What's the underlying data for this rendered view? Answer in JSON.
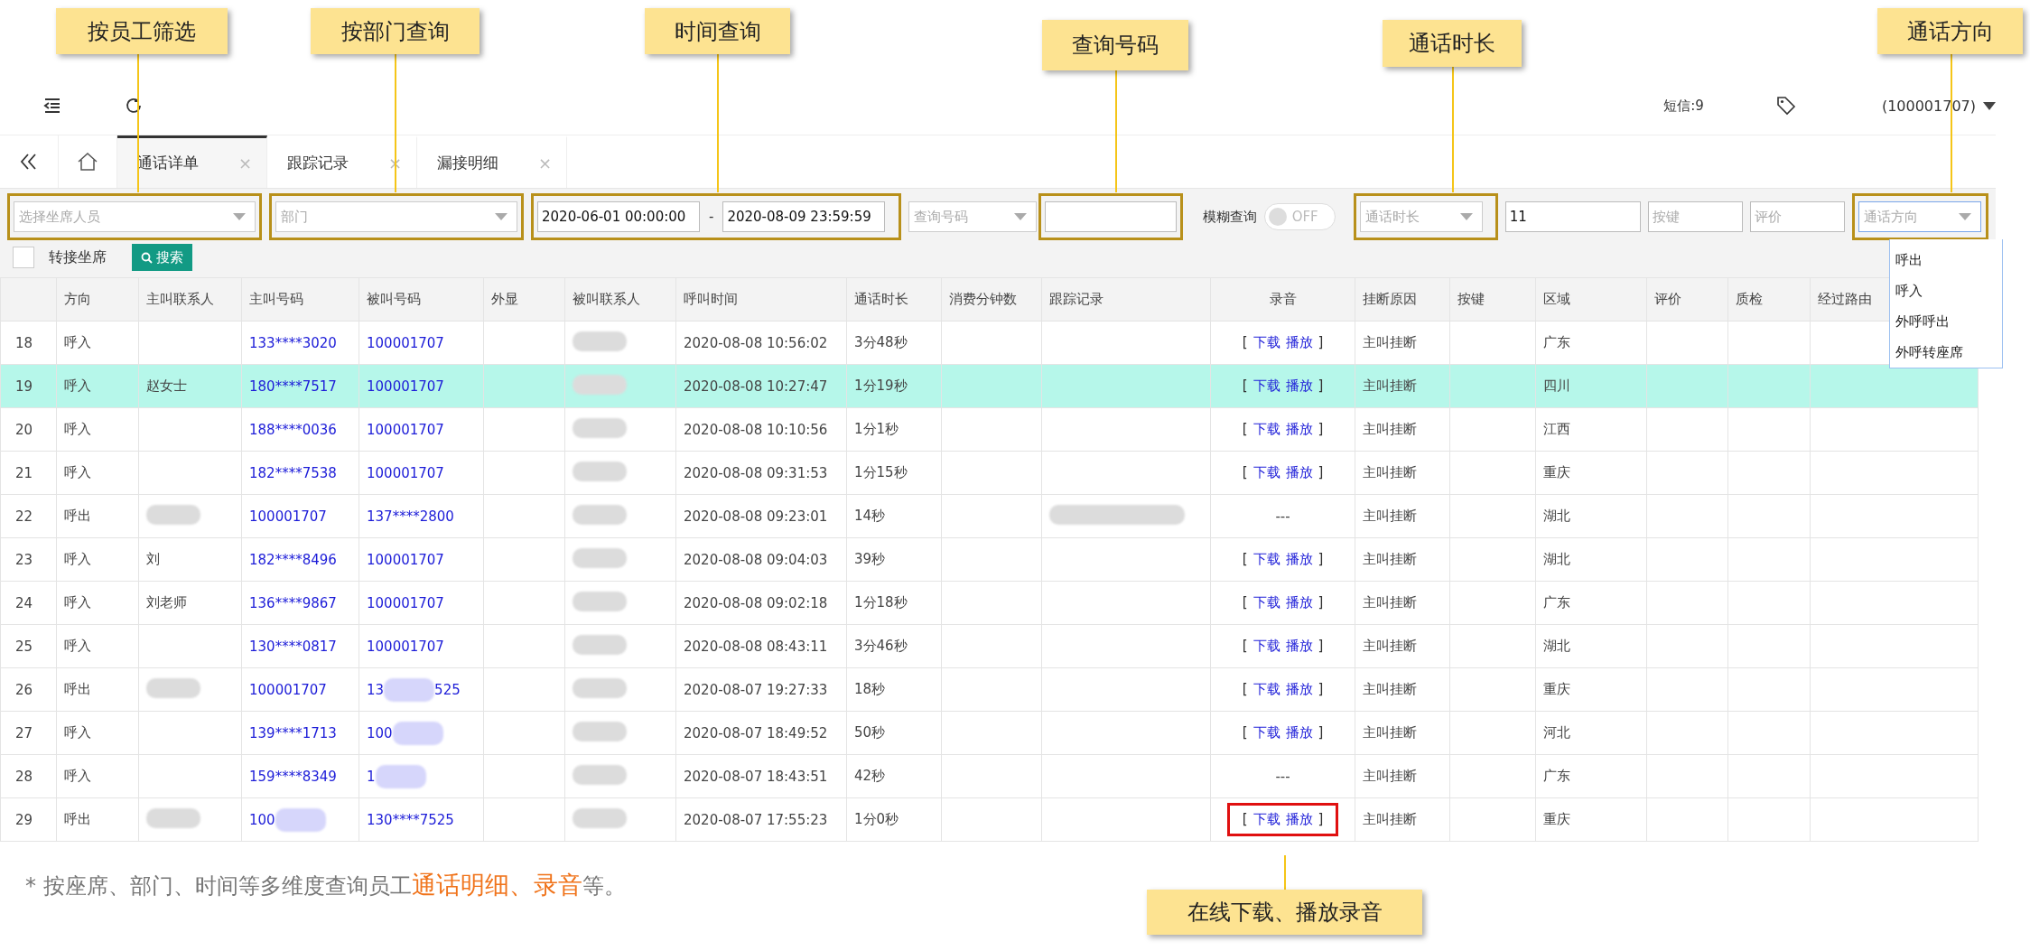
{
  "callouts": [
    {
      "label": "按员工筛选"
    },
    {
      "label": "按部门查询"
    },
    {
      "label": "时间查询"
    },
    {
      "label": "查询号码"
    },
    {
      "label": "通话时长"
    },
    {
      "label": "通话方向"
    },
    {
      "label": "在线下载、播放录音"
    }
  ],
  "header": {
    "sms": "短信:9",
    "account": "(100001707)"
  },
  "tabs": [
    {
      "label": "通话详单",
      "close": "×",
      "selected": true
    },
    {
      "label": "跟踪记录",
      "close": "×",
      "selected": false
    },
    {
      "label": "漏接明细",
      "close": "×",
      "selected": false
    }
  ],
  "filters": {
    "agent": {
      "placeholder": "选择坐席人员"
    },
    "department": {
      "placeholder": "部门"
    },
    "time_start": {
      "value": "2020-06-01 00:00:00"
    },
    "time_sep": "-",
    "time_end": {
      "value": "2020-08-09 23:59:59"
    },
    "number_type": {
      "placeholder": "查询号码"
    },
    "number": {
      "kind": "input"
    },
    "fuzzy": {
      "label": "模糊查询",
      "on": false,
      "text": "OFF"
    },
    "duration": {
      "placeholder": "通话时长"
    },
    "duration_value": {
      "value": "11"
    },
    "key": {
      "placeholder": "按键"
    },
    "rating": {
      "placeholder": "评价"
    },
    "direction": {
      "placeholder": "通话方向",
      "expanded": true,
      "options": [
        "呼出",
        "呼入",
        "外呼呼出",
        "外呼转座席"
      ]
    }
  },
  "transfer": {
    "label": "转接坐席",
    "checked": false
  },
  "search_button": "搜索",
  "table": {
    "columns": [
      {
        "label": "方向",
        "kind": "text"
      },
      {
        "label": "主叫联系人",
        "kind": "text"
      },
      {
        "label": "主叫号码",
        "kind": "phone"
      },
      {
        "label": "被叫号码",
        "kind": "phone"
      },
      {
        "label": "外显",
        "kind": "text"
      },
      {
        "label": "被叫联系人",
        "kind": "text"
      },
      {
        "label": "呼叫时间",
        "kind": "text"
      },
      {
        "label": "通话时长",
        "kind": "text"
      },
      {
        "label": "消费分钟数",
        "kind": "text"
      },
      {
        "label": "跟踪记录",
        "kind": "text"
      },
      {
        "label": "录音",
        "kind": "center"
      },
      {
        "label": "挂断原因",
        "kind": "text"
      },
      {
        "label": "按键",
        "kind": "text"
      },
      {
        "label": "区域",
        "kind": "text"
      },
      {
        "label": "评价",
        "kind": "text"
      },
      {
        "label": "质检",
        "kind": "text"
      },
      {
        "label": "经过路由",
        "kind": "text"
      }
    ],
    "rows": [
      {
        "no": "18",
        "selected": false,
        "cells": [
          "呼入",
          null,
          "133****3020",
          "100001707",
          null,
          {
            "kind": "redacted"
          },
          "2020-08-08 10:56:02",
          "3分48秒",
          null,
          null,
          {
            "kind": "recording",
            "open": "[",
            "download": "下载",
            "play": "播放",
            "close": "]"
          },
          "主叫挂断",
          null,
          "广东",
          null,
          null,
          null
        ]
      },
      {
        "no": "19",
        "selected": true,
        "cells": [
          "呼入",
          "赵女士",
          "180****7517",
          "100001707",
          null,
          {
            "kind": "redacted"
          },
          "2020-08-08 10:27:47",
          "1分19秒",
          null,
          null,
          {
            "kind": "recording",
            "open": "[",
            "download": "下载",
            "play": "播放",
            "close": "]"
          },
          "主叫挂断",
          null,
          "四川",
          null,
          null,
          null
        ]
      },
      {
        "no": "20",
        "selected": false,
        "cells": [
          "呼入",
          null,
          "188****0036",
          "100001707",
          null,
          {
            "kind": "redacted"
          },
          "2020-08-08 10:10:56",
          "1分1秒",
          null,
          null,
          {
            "kind": "recording",
            "open": "[",
            "download": "下载",
            "play": "播放",
            "close": "]"
          },
          "主叫挂断",
          null,
          "江西",
          null,
          null,
          null
        ]
      },
      {
        "no": "21",
        "selected": false,
        "cells": [
          "呼入",
          null,
          "182****7538",
          "100001707",
          null,
          {
            "kind": "redacted"
          },
          "2020-08-08 09:31:53",
          "1分15秒",
          null,
          null,
          {
            "kind": "recording",
            "open": "[",
            "download": "下载",
            "play": "播放",
            "close": "]"
          },
          "主叫挂断",
          null,
          "重庆",
          null,
          null,
          null
        ]
      },
      {
        "no": "22",
        "selected": false,
        "cells": [
          "呼出",
          {
            "kind": "redacted"
          },
          "100001707",
          "137****2800",
          null,
          {
            "kind": "redacted"
          },
          "2020-08-08 09:23:01",
          "14秒",
          null,
          {
            "kind": "redacted"
          },
          "---",
          "主叫挂断",
          null,
          "湖北",
          null,
          null,
          null
        ]
      },
      {
        "no": "23",
        "selected": false,
        "cells": [
          "呼入",
          "刘",
          "182****8496",
          "100001707",
          null,
          {
            "kind": "redacted"
          },
          "2020-08-08 09:04:03",
          "39秒",
          null,
          null,
          {
            "kind": "recording",
            "open": "[",
            "download": "下载",
            "play": "播放",
            "close": "]"
          },
          "主叫挂断",
          null,
          "湖北",
          null,
          null,
          null
        ]
      },
      {
        "no": "24",
        "selected": false,
        "cells": [
          "呼入",
          "刘老师",
          "136****9867",
          "100001707",
          null,
          {
            "kind": "redacted"
          },
          "2020-08-08 09:02:18",
          "1分18秒",
          null,
          null,
          {
            "kind": "recording",
            "open": "[",
            "download": "下载",
            "play": "播放",
            "close": "]"
          },
          "主叫挂断",
          null,
          "广东",
          null,
          null,
          null
        ]
      },
      {
        "no": "25",
        "selected": false,
        "cells": [
          "呼入",
          null,
          "130****0817",
          "100001707",
          null,
          {
            "kind": "redacted"
          },
          "2020-08-08 08:43:11",
          "3分46秒",
          null,
          null,
          {
            "kind": "recording",
            "open": "[",
            "download": "下载",
            "play": "播放",
            "close": "]"
          },
          "主叫挂断",
          null,
          "湖北",
          null,
          null,
          null
        ]
      },
      {
        "no": "26",
        "selected": false,
        "cells": [
          "呼出",
          {
            "kind": "redacted"
          },
          "100001707",
          {
            "kind": "redacted",
            "pre": "13",
            "post": "525"
          },
          null,
          {
            "kind": "redacted"
          },
          "2020-08-07 19:27:33",
          "18秒",
          null,
          null,
          {
            "kind": "recording",
            "open": "[",
            "download": "下载",
            "play": "播放",
            "close": "]"
          },
          "主叫挂断",
          null,
          "重庆",
          null,
          null,
          null
        ]
      },
      {
        "no": "27",
        "selected": false,
        "cells": [
          "呼入",
          null,
          "139****1713",
          {
            "kind": "redacted",
            "pre": "100"
          },
          null,
          {
            "kind": "redacted"
          },
          "2020-08-07 18:49:52",
          "50秒",
          null,
          null,
          {
            "kind": "recording",
            "open": "[",
            "download": "下载",
            "play": "播放",
            "close": "]"
          },
          "主叫挂断",
          null,
          "河北",
          null,
          null,
          null
        ]
      },
      {
        "no": "28",
        "selected": false,
        "cells": [
          "呼入",
          null,
          "159****8349",
          {
            "kind": "redacted",
            "pre": "1"
          },
          null,
          {
            "kind": "redacted"
          },
          "2020-08-07 18:43:51",
          "42秒",
          null,
          null,
          "---",
          "主叫挂断",
          null,
          "广东",
          null,
          null,
          null
        ]
      },
      {
        "no": "29",
        "selected": false,
        "cells": [
          "呼出",
          {
            "kind": "redacted"
          },
          {
            "kind": "redacted",
            "pre": "100"
          },
          "130****7525",
          null,
          {
            "kind": "redacted"
          },
          "2020-08-07 17:55:23",
          "1分0秒",
          null,
          null,
          {
            "kind": "recording",
            "open": "[",
            "download": "下载",
            "play": "播放",
            "close": "]",
            "callout": true
          },
          "主叫挂断",
          null,
          "重庆",
          null,
          null,
          null
        ]
      }
    ]
  },
  "caption": {
    "lead": "* 按座席、部门、时间等多维度查询员工",
    "highlight": "通话明细、录音",
    "tail": "等。"
  }
}
